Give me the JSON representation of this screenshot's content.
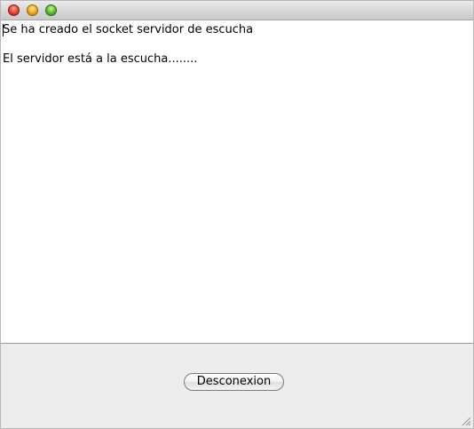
{
  "window": {
    "title": ""
  },
  "log": {
    "lines": [
      "Se ha creado el socket servidor de escucha",
      "",
      "El servidor está a la escucha........"
    ]
  },
  "actions": {
    "disconnect_label": "Desconexion"
  },
  "icons": {
    "close": "close-icon",
    "minimize": "minimize-icon",
    "zoom": "zoom-icon",
    "resize": "resize-grip-icon"
  },
  "colors": {
    "close": "#f04a3a",
    "minimize": "#f5b324",
    "zoom": "#6cc23a",
    "window_bg": "#ececec",
    "text_bg": "#ffffff"
  }
}
